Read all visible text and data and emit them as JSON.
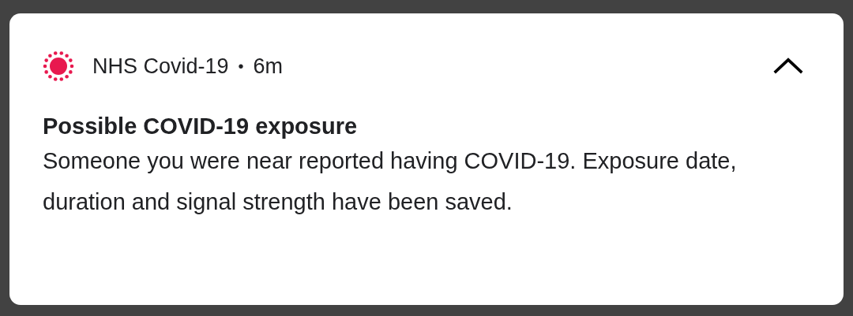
{
  "notification": {
    "app_name": "NHS Covid-19",
    "separator": "•",
    "time": "6m",
    "expanded": true,
    "title": "Possible COVID-19 exposure",
    "body": "Someone you were near reported having COVID-19. Exposure date, duration and signal strength have been saved."
  }
}
